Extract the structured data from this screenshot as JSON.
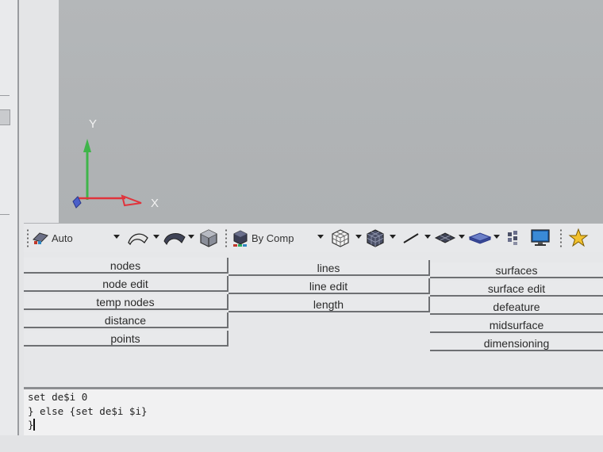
{
  "viewport": {
    "axis_labels": {
      "y": "Y",
      "x": "X"
    },
    "colors": {
      "y_axis": "#3fb54a",
      "x_axis": "#e0343c",
      "z_marker": "#4a5fc9",
      "background": "#b2b5b7"
    }
  },
  "toolbar": {
    "display_mode": {
      "value": "Auto",
      "icon": "display-mode-icon"
    },
    "color_mode": {
      "value": "By Comp",
      "icon": "color-by-component-icon"
    },
    "icons": [
      "shaded-surface-icon",
      "dark-surface-icon",
      "solid-cube-icon",
      "wireframe-cube-icon",
      "shaded-cube-icon",
      "line-icon",
      "plane-mesh-icon",
      "plate-icon",
      "element-grid-icon",
      "monitor-icon",
      "star-icon"
    ]
  },
  "panel": {
    "col1": [
      "nodes",
      "node edit",
      "temp nodes",
      "distance",
      "points"
    ],
    "col2": [
      "lines",
      "line edit",
      "length"
    ],
    "col3": [
      "surfaces",
      "surface edit",
      "defeature",
      "midsurface",
      "dimensioning"
    ]
  },
  "console": {
    "lines": [
      "set de$i 0",
      "} else {set de$i $i}",
      "}"
    ]
  }
}
